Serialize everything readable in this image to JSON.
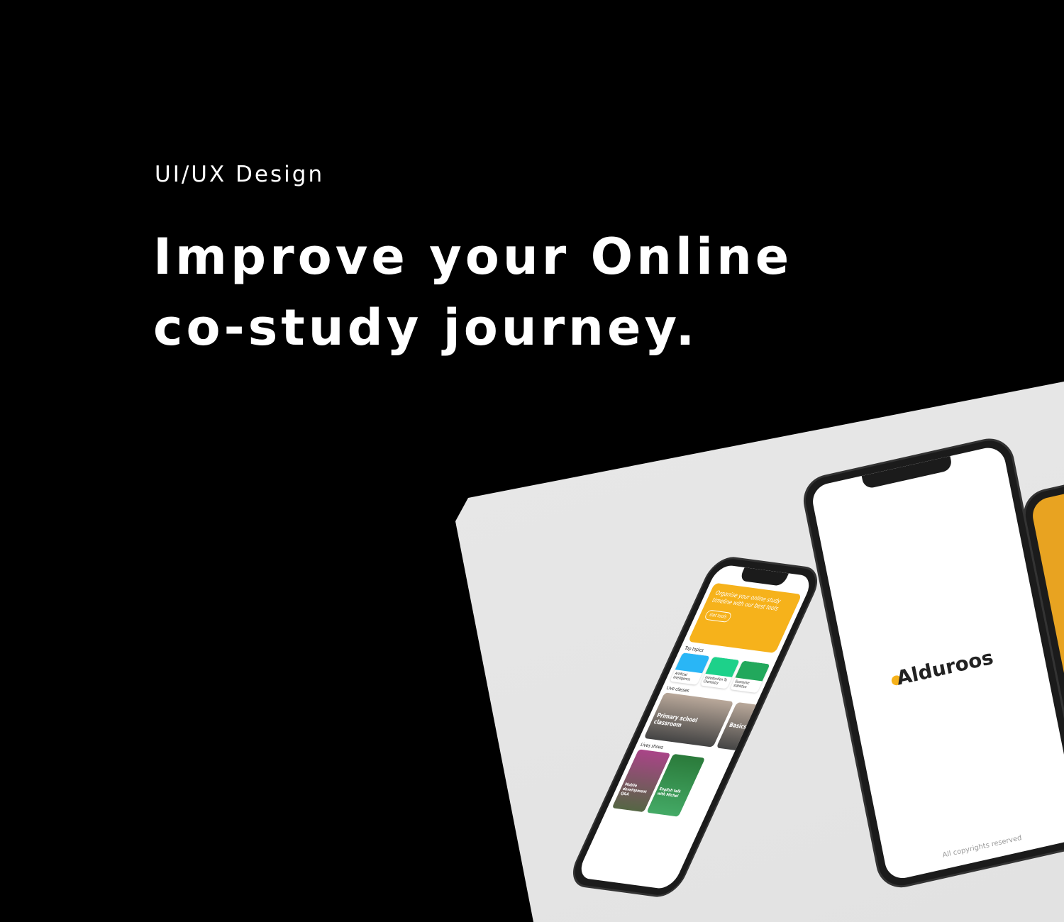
{
  "eyebrow": "UI/UX Design",
  "headline": {
    "line1": "Improve your Online",
    "line2": "co-study journey."
  },
  "app": {
    "brand": "Alduroos",
    "splash_footer": "All copyrights reserved",
    "hero": {
      "text": "Organise your online study timeline with our best tools",
      "button": "Get tools"
    },
    "top_topics_label": "Top topics",
    "topics": [
      {
        "title": "Artificial Intelligence",
        "color": "#29b6f6"
      },
      {
        "title": "Introduction To Chemistry",
        "color": "#1dd18a"
      },
      {
        "title": "Economic statistics",
        "color": "#22a85c"
      }
    ],
    "live_classes_label": "Live classes",
    "live_classes": [
      "Primary school classroom",
      "Basics of speaking"
    ],
    "live_shows_label": "Lives shows",
    "live_shows": [
      "Mobile development Q&A",
      "English talk with Michel"
    ]
  }
}
